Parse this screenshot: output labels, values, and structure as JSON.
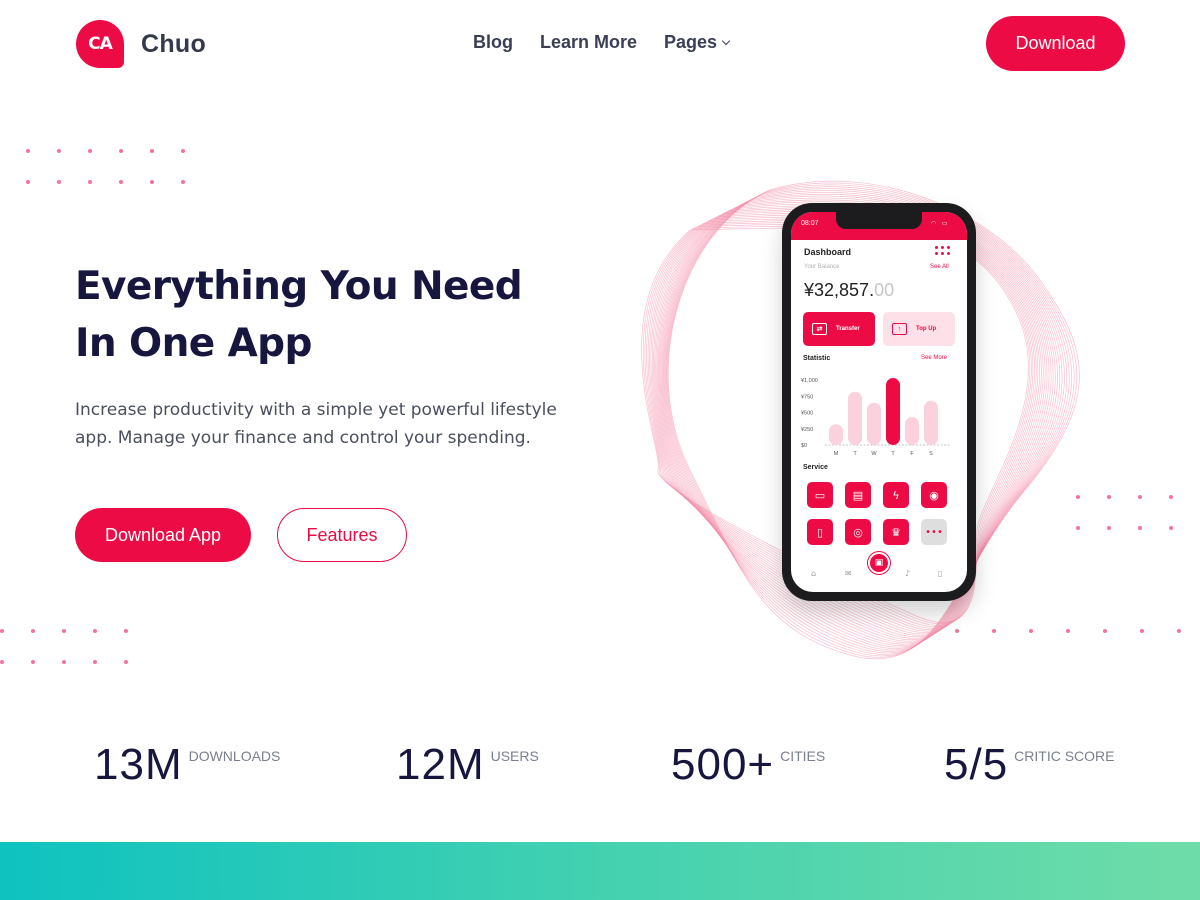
{
  "brand": {
    "logo_text": "CA",
    "name": "Chuo",
    "accent": "#ec0b45"
  },
  "nav": {
    "items": [
      {
        "label": "Blog"
      },
      {
        "label": "Learn More"
      },
      {
        "label": "Pages"
      }
    ],
    "download_label": "Download"
  },
  "hero": {
    "title_line1": "Everything You Need",
    "title_line2": "In One App",
    "subtitle": "Increase productivity with a simple yet powerful lifestyle app. Manage your finance and control your spending.",
    "primary_button": "Download App",
    "secondary_button": "Features"
  },
  "phone": {
    "time": "08:07",
    "dashboard": "Dashboard",
    "your_balance": "Your Balance",
    "see_all": "See All",
    "balance_main": "¥32,857.",
    "balance_cents": "00",
    "transfer": "Transfer",
    "top_up": "Top Up",
    "statistic": "Statistic",
    "see_more": "See More",
    "service": "Service",
    "chart": {
      "y_ticks": [
        "¥1,000",
        "¥750",
        "¥500",
        "¥250",
        "$0"
      ],
      "days": [
        "M",
        "T",
        "W",
        "T",
        "F",
        "S"
      ],
      "values": [
        320,
        820,
        650,
        1030,
        430,
        680
      ],
      "highlight_index": 3
    }
  },
  "stats": [
    {
      "number": "13M",
      "label": "DOWNLOADS"
    },
    {
      "number": "12M",
      "label": "USERS"
    },
    {
      "number": "500+",
      "label": "CITIES"
    },
    {
      "number": "5/5",
      "label": "CRITIC SCORE"
    }
  ]
}
